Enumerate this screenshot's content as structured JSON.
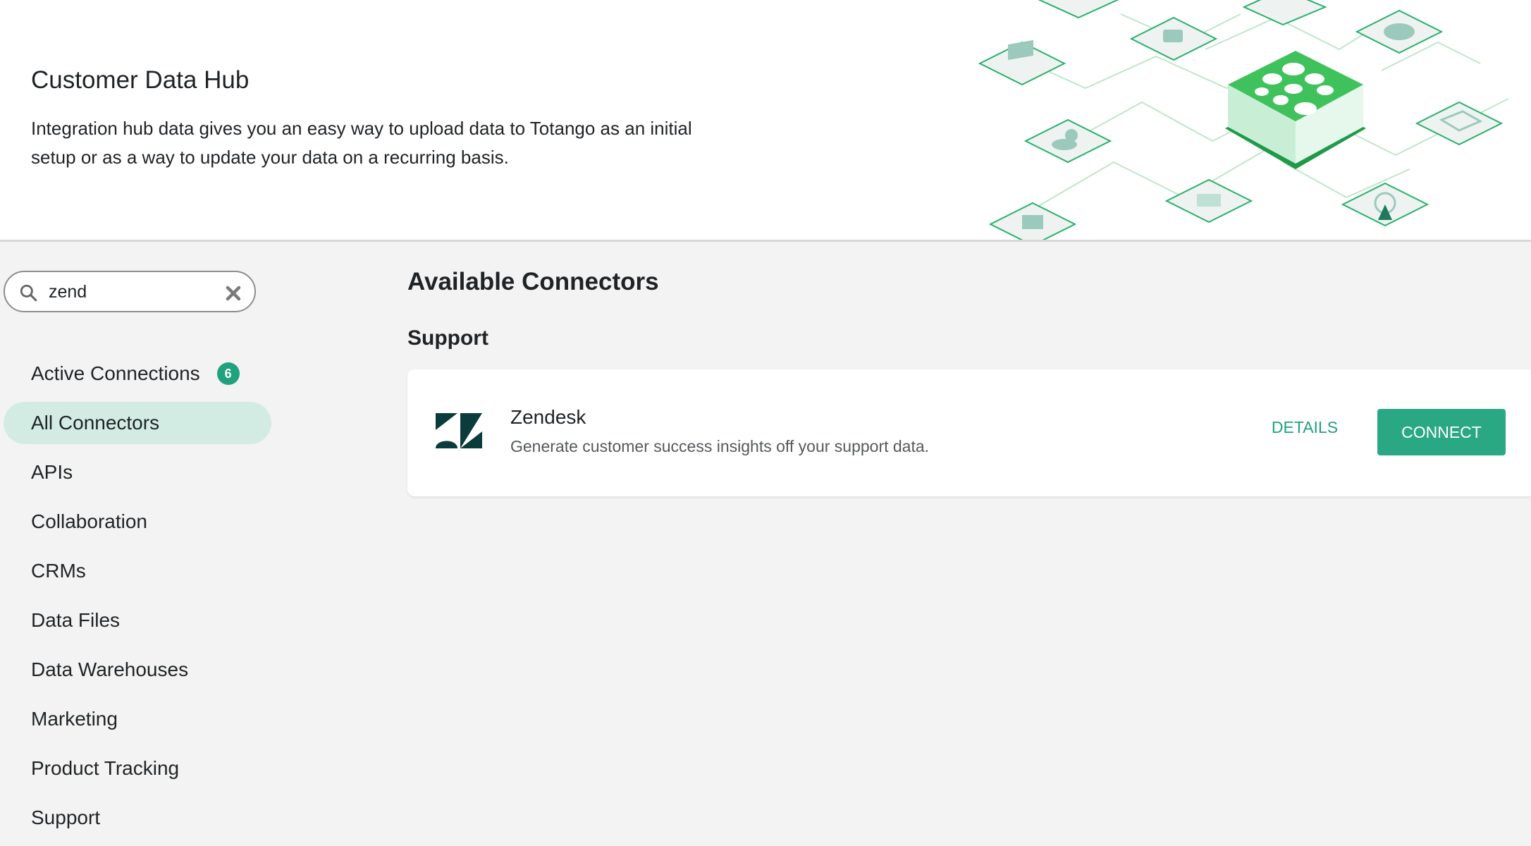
{
  "header": {
    "title": "Customer Data Hub",
    "description": "Integration hub data gives you an easy way to upload data to Totango as an initial setup or as a way to update your data on a recurring basis."
  },
  "search": {
    "value": "zend",
    "icon": "search-icon",
    "clear_icon": "close-icon"
  },
  "sidebar": {
    "items": [
      {
        "label": "Active Connections",
        "badge": "6",
        "active": false
      },
      {
        "label": "All Connectors",
        "active": true
      },
      {
        "label": "APIs",
        "active": false
      },
      {
        "label": "Collaboration",
        "active": false
      },
      {
        "label": "CRMs",
        "active": false
      },
      {
        "label": "Data Files",
        "active": false
      },
      {
        "label": "Data Warehouses",
        "active": false
      },
      {
        "label": "Marketing",
        "active": false
      },
      {
        "label": "Product Tracking",
        "active": false
      },
      {
        "label": "Support",
        "active": false
      }
    ]
  },
  "main": {
    "section_title": "Available Connectors",
    "categories": [
      {
        "title": "Support",
        "connectors": [
          {
            "name": "Zendesk",
            "description": "Generate customer success insights off your support data.",
            "details_label": "DETAILS",
            "connect_label": "CONNECT",
            "logo_icon": "zendesk-logo-icon"
          }
        ]
      }
    ]
  },
  "colors": {
    "accent": "#2aa884",
    "accent_text": "#1fa27e",
    "active_bg": "#d3ece3",
    "badge": "#1fa27e"
  }
}
